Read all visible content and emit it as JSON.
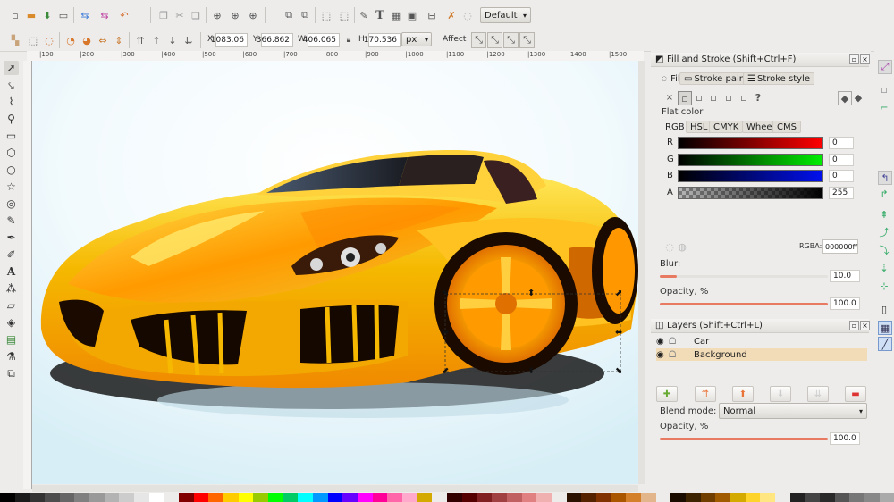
{
  "cmdbar": {
    "zoom_combo": "Default",
    "icons": [
      "new-document-icon",
      "open-icon",
      "save-icon",
      "print-icon",
      "import-icon",
      "export-icon",
      "undo-icon",
      "redo-icon",
      "copy-icon",
      "cut-icon",
      "paste-icon",
      "zoom-selection-icon",
      "zoom-drawing-icon",
      "zoom-page-icon",
      "duplicate-icon",
      "clone-icon",
      "unlink-clone-icon",
      "group-icon",
      "ungroup-icon",
      "xml-editor-icon",
      "text-font-icon",
      "layers-icon",
      "align-icon",
      "preferences-icon",
      "symbols-icon"
    ]
  },
  "ctrlbar": {
    "x_label": "X",
    "x_value": "1083.06",
    "y_label": "Y",
    "y_value": "366.862",
    "w_label": "W",
    "w_value": "406.065",
    "h_label": "H",
    "h_value": "170.536",
    "unit": "px",
    "affect_label": "Affect"
  },
  "ruler": {
    "ticks": [
      "|100",
      "|200",
      "|300",
      "|400",
      "|500",
      "|600",
      "|700",
      "|800",
      "|900",
      "|1000",
      "|1100",
      "|1200",
      "|1300",
      "|1400",
      "|1500"
    ]
  },
  "fill_stroke": {
    "title": "Fill and Stroke (Shift+Ctrl+F)",
    "tab_fill": "Fill",
    "tab_stroke_paint": "Stroke paint",
    "tab_stroke_style": "Stroke style",
    "paint_type_unset": "?",
    "flat_color_label": "Flat color",
    "color_tabs": [
      "RGB",
      "HSL",
      "CMYK",
      "Wheel",
      "CMS"
    ],
    "channels": [
      {
        "label": "R",
        "value": "0"
      },
      {
        "label": "G",
        "value": "0"
      },
      {
        "label": "B",
        "value": "0"
      },
      {
        "label": "A",
        "value": "255"
      }
    ],
    "rgba_label": "RGBA:",
    "rgba_value": "000000ff",
    "blur_label": "Blur:",
    "blur_value": "10.0",
    "blur_level": 0.1,
    "opacity_label": "Opacity, %",
    "opacity_value": "100.0",
    "opacity_level": 1.0
  },
  "layers": {
    "title": "Layers (Shift+Ctrl+L)",
    "items": [
      {
        "name": "Car",
        "selected": false
      },
      {
        "name": "Background",
        "selected": true
      }
    ],
    "blend_label": "Blend mode:",
    "blend_value": "Normal",
    "opacity_label": "Opacity, %",
    "opacity_value": "100.0",
    "opacity_level": 1.0
  },
  "colors": {
    "accent": "#e87a62",
    "selected_layer": "#f2dcb8",
    "car_body": "#f5c21a",
    "car_orange": "#f08a00",
    "canvas_bg": "#dff2f8"
  }
}
